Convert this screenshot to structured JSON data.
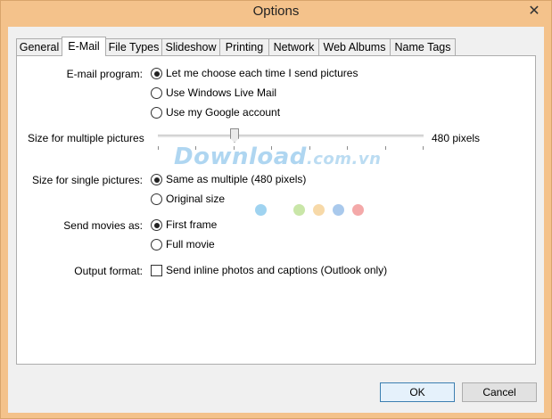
{
  "window": {
    "title": "Options",
    "close_glyph": "✕"
  },
  "tabs": [
    {
      "label": "General",
      "active": false
    },
    {
      "label": "E-Mail",
      "active": true
    },
    {
      "label": "File Types",
      "active": false
    },
    {
      "label": "Slideshow",
      "active": false
    },
    {
      "label": "Printing",
      "active": false
    },
    {
      "label": "Network",
      "active": false
    },
    {
      "label": "Web Albums",
      "active": false
    },
    {
      "label": "Name Tags",
      "active": false
    }
  ],
  "email_program": {
    "label": "E-mail program:",
    "options": [
      {
        "label": "Let me choose each time I send pictures",
        "checked": true
      },
      {
        "label": "Use Windows Live Mail",
        "checked": false
      },
      {
        "label": "Use my Google account",
        "checked": false
      }
    ]
  },
  "multi_size": {
    "label": "Size for multiple pictures",
    "value_text": "480 pixels",
    "slider_fraction": 0.29
  },
  "single_size": {
    "label": "Size for single pictures:",
    "options": [
      {
        "label": "Same as multiple (480 pixels)",
        "checked": true
      },
      {
        "label": "Original size",
        "checked": false
      }
    ]
  },
  "movies": {
    "label": "Send movies as:",
    "options": [
      {
        "label": "First frame",
        "checked": true
      },
      {
        "label": "Full movie",
        "checked": false
      }
    ]
  },
  "output_format": {
    "label": "Output format:",
    "checkbox_label": "Send inline photos and captions (Outlook only)",
    "checked": false
  },
  "watermark": {
    "main": "Download",
    "sub": ".com.vn"
  },
  "watermark_dot_colors": [
    "#9fd3f0",
    "#c9e6a8",
    "#f7d9a8",
    "#a9c9ec",
    "#f4a9a9"
  ],
  "buttons": {
    "ok": "OK",
    "cancel": "Cancel"
  }
}
